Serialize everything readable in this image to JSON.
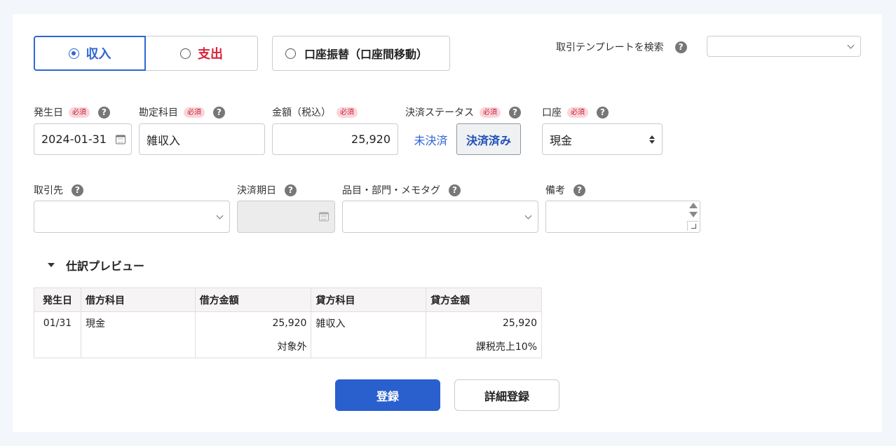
{
  "type_toggle": {
    "income_label": "収入",
    "expense_label": "支出",
    "transfer_label": "口座振替（口座間移動）",
    "selected": "income"
  },
  "template_search": {
    "label": "取引テンプレートを検索",
    "value": ""
  },
  "help_glyph": "?",
  "required_badge": "必須",
  "fields": {
    "date": {
      "label": "発生日",
      "value": "2024-01-31"
    },
    "account_item": {
      "label": "勘定科目",
      "value": "雑収入"
    },
    "amount": {
      "label": "金額（税込）",
      "value": "25,920"
    },
    "payment_status": {
      "label": "決済ステータス",
      "unpaid_label": "未決済",
      "paid_label": "決済済み",
      "selected": "paid"
    },
    "wallet": {
      "label": "口座",
      "value": "現金"
    },
    "partner": {
      "label": "取引先",
      "value": ""
    },
    "due_date": {
      "label": "決済期日",
      "value": ""
    },
    "tags": {
      "label": "品目・部門・メモタグ",
      "value": ""
    },
    "memo": {
      "label": "備考",
      "value": ""
    }
  },
  "preview": {
    "title": "仕訳プレビュー",
    "headers": [
      "発生日",
      "借方科目",
      "借方金額",
      "貸方科目",
      "貸方金額"
    ],
    "row": {
      "date": "01/31",
      "debit_account": "現金",
      "debit_amount": "25,920",
      "debit_tax": "対象外",
      "credit_account": "雑収入",
      "credit_amount": "25,920",
      "credit_tax": "課税売上10%"
    }
  },
  "buttons": {
    "register": "登録",
    "detail_register": "詳細登録"
  },
  "colors": {
    "accent": "#2f66d2",
    "expense": "#d8243a",
    "primary_button": "#2a5fce",
    "required_bg": "#fbd5da"
  }
}
